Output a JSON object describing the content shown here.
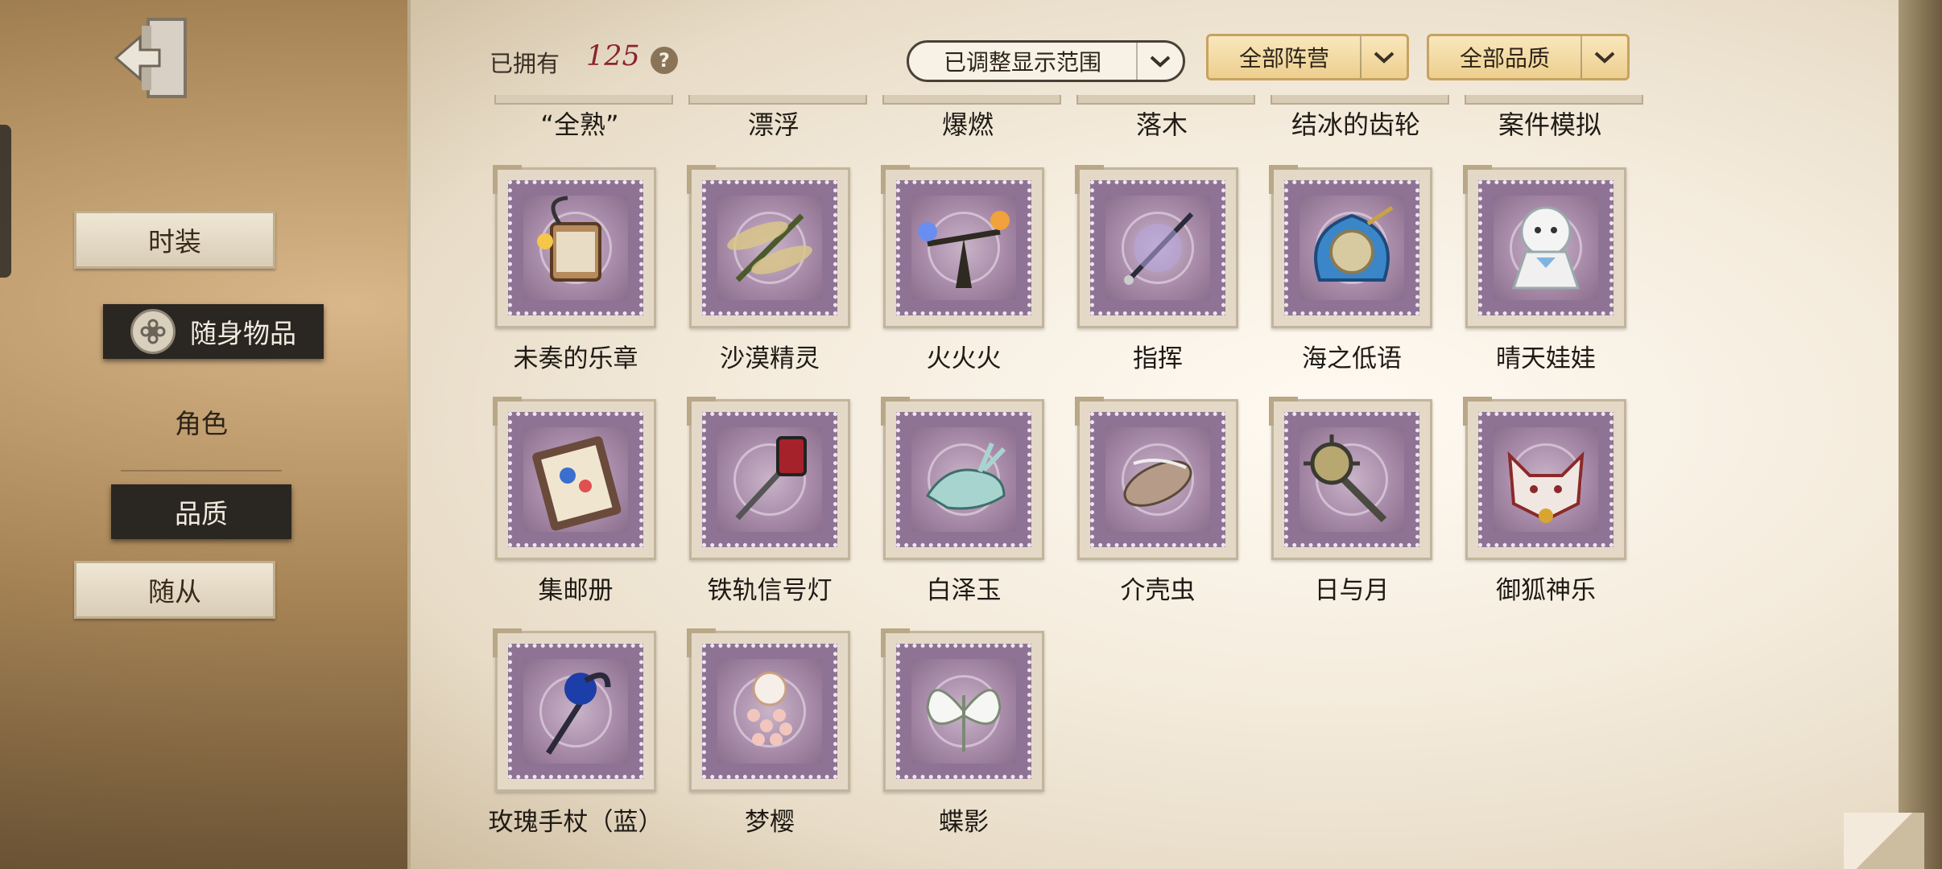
{
  "sidebar": {
    "nav": [
      "时装",
      "随身物品",
      "角色",
      "品质",
      "随从"
    ]
  },
  "header": {
    "owned_label": "已拥有",
    "owned_count": "125",
    "help": "?",
    "range_filter": "已调整显示范围",
    "camp_filter": "全部阵营",
    "quality_filter": "全部品质"
  },
  "top_row": [
    "“全熟”",
    "漂浮",
    "爆燃",
    "落木",
    "结冰的齿轮",
    "案件模拟"
  ],
  "cards": [
    {
      "name": "未奏的乐章",
      "icon": "dynamite-icon"
    },
    {
      "name": "沙漠精灵",
      "icon": "dragonfly-icon"
    },
    {
      "name": "火火火",
      "icon": "seesaw-flame-icon"
    },
    {
      "name": "指挥",
      "icon": "baton-icon"
    },
    {
      "name": "海之低语",
      "icon": "seashell-icon"
    },
    {
      "name": "晴天娃娃",
      "icon": "doll-icon"
    },
    {
      "name": "集邮册",
      "icon": "stamp-album-icon"
    },
    {
      "name": "铁轨信号灯",
      "icon": "signal-lamp-icon"
    },
    {
      "name": "白泽玉",
      "icon": "jade-beast-icon"
    },
    {
      "name": "介壳虫",
      "icon": "beetle-icon"
    },
    {
      "name": "日与月",
      "icon": "sun-key-icon"
    },
    {
      "name": "御狐神乐",
      "icon": "fox-mask-icon"
    },
    {
      "name": "玫瑰手杖（蓝）",
      "icon": "rose-cane-icon"
    },
    {
      "name": "梦樱",
      "icon": "sakura-hairpin-icon"
    },
    {
      "name": "蝶影",
      "icon": "butterfly-icon"
    }
  ]
}
